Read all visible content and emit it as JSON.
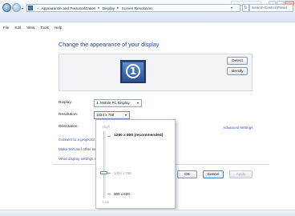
{
  "window": {
    "title_badge": "",
    "controls": [
      "minimize",
      "maximize",
      "close"
    ]
  },
  "address_bar": {
    "breadcrumbs": [
      "Appearance and Personalization",
      "Display",
      "Screen Resolution"
    ],
    "search_placeholder": "Search Control Panel",
    "refresh_glyph": "↻"
  },
  "menu": [
    "File",
    "Edit",
    "View",
    "Tools",
    "Help"
  ],
  "page": {
    "heading": "Change the appearance of your display",
    "monitor_number": "1",
    "detect_label": "Detect",
    "identify_label": "Identify"
  },
  "settings": {
    "display_label": "Display:",
    "display_value": "1. Mobile PC Display",
    "resolution_label": "Resolution:",
    "resolution_value": "1024 x 768",
    "orientation_label": "Orientation:",
    "advanced_link": "Advanced settings"
  },
  "links": [
    "Connect to a projector",
    "Make text and other items larger or smaller",
    "What display settings should I choose?"
  ],
  "buttons": {
    "ok": "OK",
    "cancel": "Cancel",
    "apply": "Apply"
  },
  "resolution_popup": {
    "high_label": "High",
    "low_label": "Low",
    "options": [
      "1280 x 800 (recommended)",
      "1024 x 768",
      "800 x 600"
    ],
    "selected": "1024 x 768",
    "slider_level": 0.4
  },
  "colors": {
    "heading": "#1f3f8e",
    "link": "#2b57b8",
    "address_bg": "#dbe6f3"
  }
}
